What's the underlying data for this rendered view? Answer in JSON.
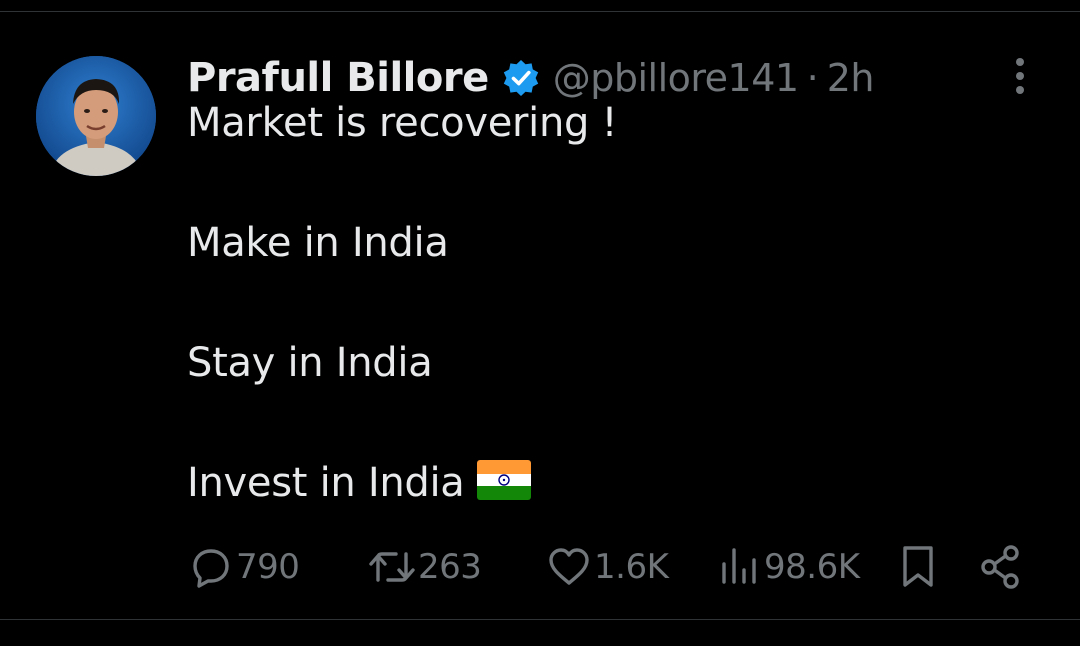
{
  "author": {
    "name": "Prafull Billore",
    "handle": "@pbillore141",
    "separator": "·",
    "time": "2h"
  },
  "post": {
    "lines": [
      "Market is recovering !",
      "Make in India",
      "Stay in India",
      "Invest in India"
    ]
  },
  "actions": {
    "replies": "790",
    "reposts": "263",
    "likes": "1.6K",
    "views": "98.6K"
  },
  "colors": {
    "background": "#000000",
    "text": "#e7e9ea",
    "muted": "#71767b",
    "verified": "#1d9bf0"
  },
  "icons": [
    "verified-badge-icon",
    "more-options-icon",
    "reply-icon",
    "repost-icon",
    "like-icon",
    "views-icon",
    "bookmark-icon",
    "share-icon",
    "india-flag-icon"
  ]
}
